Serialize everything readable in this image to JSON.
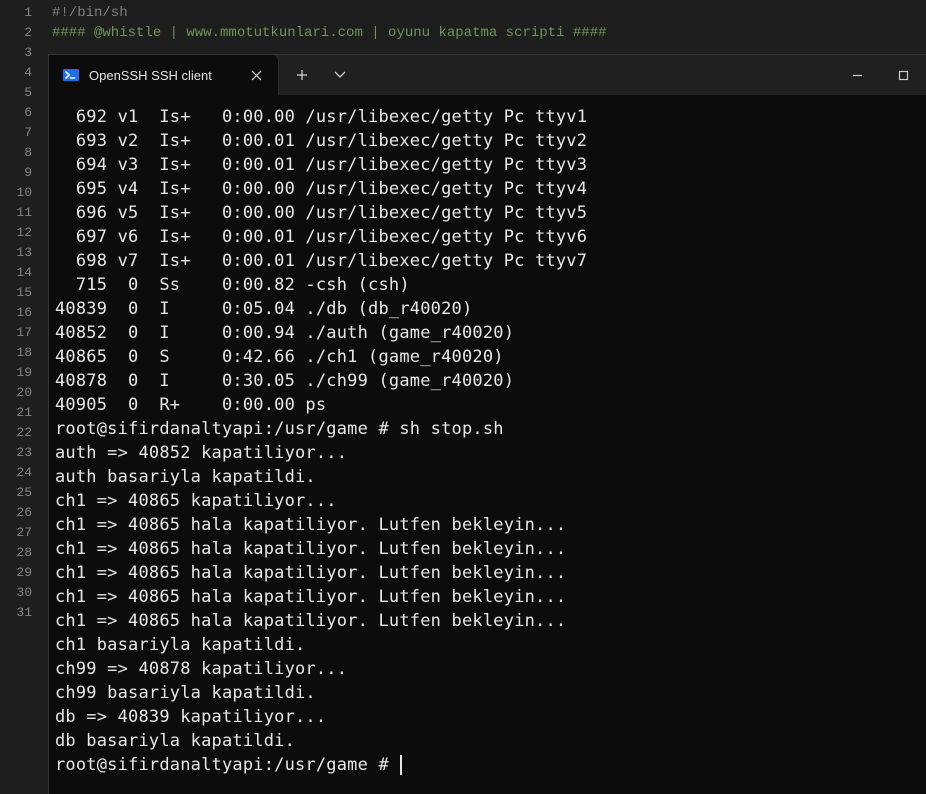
{
  "editor": {
    "line_numbers": [
      "1",
      "2",
      "3",
      "4",
      "5",
      "6",
      "7",
      "8",
      "9",
      "10",
      "11",
      "12",
      "13",
      "14",
      "15",
      "16",
      "17",
      "18",
      "19",
      "20",
      "21",
      "22",
      "23",
      "24",
      "25",
      "26",
      "27",
      "28",
      "29",
      "30",
      "31"
    ],
    "line1": "#!/bin/sh",
    "line2": "#### @whistle | www.mmotutkunlari.com | oyunu kapatma scripti ####"
  },
  "titlebar": {
    "tab_title": "OpenSSH SSH client"
  },
  "terminal_lines": [
    "  692 v1  Is+   0:00.00 /usr/libexec/getty Pc ttyv1",
    "  693 v2  Is+   0:00.01 /usr/libexec/getty Pc ttyv2",
    "  694 v3  Is+   0:00.01 /usr/libexec/getty Pc ttyv3",
    "  695 v4  Is+   0:00.00 /usr/libexec/getty Pc ttyv4",
    "  696 v5  Is+   0:00.00 /usr/libexec/getty Pc ttyv5",
    "  697 v6  Is+   0:00.01 /usr/libexec/getty Pc ttyv6",
    "  698 v7  Is+   0:00.01 /usr/libexec/getty Pc ttyv7",
    "  715  0  Ss    0:00.82 -csh (csh)",
    "40839  0  I     0:05.04 ./db (db_r40020)",
    "40852  0  I     0:00.94 ./auth (game_r40020)",
    "40865  0  S     0:42.66 ./ch1 (game_r40020)",
    "40878  0  I     0:30.05 ./ch99 (game_r40020)",
    "40905  0  R+    0:00.00 ps",
    "root@sifirdanaltyapi:/usr/game # sh stop.sh",
    "auth => 40852 kapatiliyor...",
    "auth basariyla kapatildi.",
    "ch1 => 40865 kapatiliyor...",
    "ch1 => 40865 hala kapatiliyor. Lutfen bekleyin...",
    "ch1 => 40865 hala kapatiliyor. Lutfen bekleyin...",
    "ch1 => 40865 hala kapatiliyor. Lutfen bekleyin...",
    "ch1 => 40865 hala kapatiliyor. Lutfen bekleyin...",
    "ch1 => 40865 hala kapatiliyor. Lutfen bekleyin...",
    "ch1 basariyla kapatildi.",
    "ch99 => 40878 kapatiliyor...",
    "ch99 basariyla kapatildi.",
    "db => 40839 kapatiliyor...",
    "db basariyla kapatildi.",
    "root@sifirdanaltyapi:/usr/game # "
  ]
}
